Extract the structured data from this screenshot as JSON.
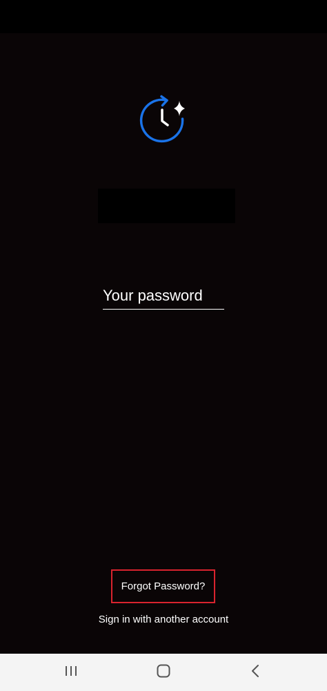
{
  "login": {
    "password_placeholder": "Your password",
    "forgot_password_label": "Forgot Password?",
    "other_account_label": "Sign in with another account"
  },
  "icons": {
    "app_logo": "clock-refresh-sparkle-icon",
    "recents": "recent-apps-icon",
    "home": "home-icon",
    "back": "back-chevron-icon"
  },
  "colors": {
    "background": "#0a0506",
    "logo_blue": "#1a73e8",
    "highlight_border": "#d9232e",
    "nav_bar": "#f4f4f4"
  }
}
